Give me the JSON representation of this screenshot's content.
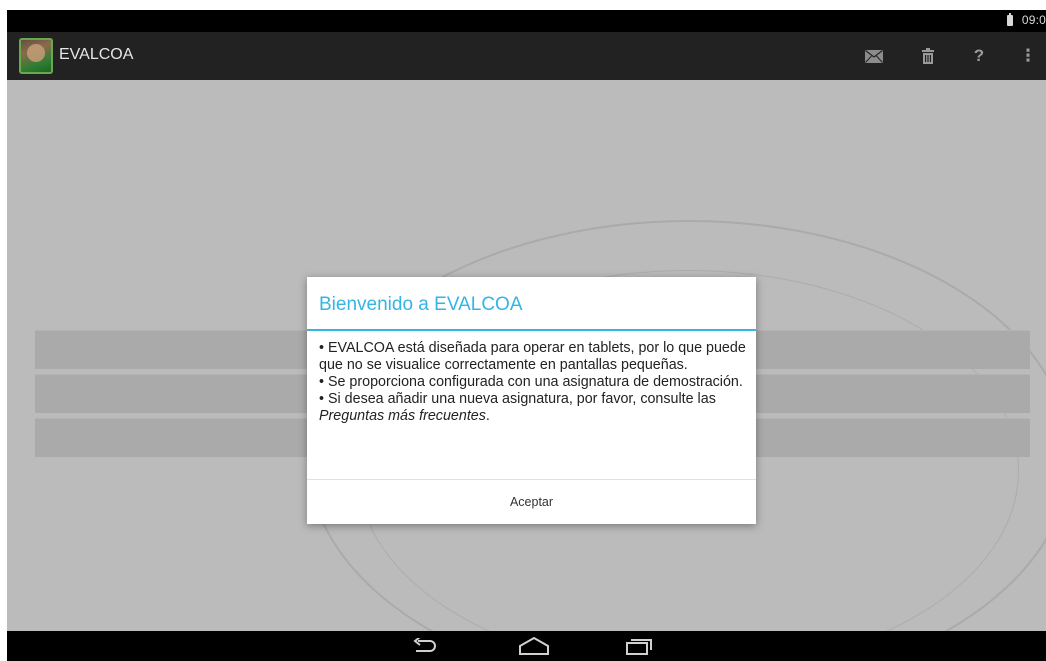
{
  "status_bar": {
    "time": "09:0"
  },
  "action_bar": {
    "title": "EVALCOA",
    "icons": [
      "app-logo-icon",
      "mail-icon",
      "trash-icon",
      "help-icon",
      "overflow-menu-icon"
    ],
    "help_glyph": "?",
    "overflow_glyph": "⋮"
  },
  "content": {
    "rows": [
      "",
      "",
      ""
    ]
  },
  "dialog": {
    "title": "Bienvenido a EVALCOA",
    "line1": "• EVALCOA está diseñada para operar en tablets, por lo que puede que no se visualice correctamente en pantallas pequeñas.",
    "line2": "• Se proporciona configurada con una asignatura de demostración.",
    "line3_prefix": "• Si desea añadir una nueva asignatura, por favor, consulte las ",
    "line3_link": "Preguntas más frecuentes",
    "line3_suffix": ".",
    "accept_label": "Aceptar"
  },
  "nav_bar": {
    "icons": [
      "back-icon",
      "home-icon",
      "recents-icon"
    ]
  },
  "colors": {
    "accent": "#33b5e5",
    "action_bar": "#222222",
    "content_bg": "#bbbbbb",
    "row_bg": "#aaaaaa"
  }
}
